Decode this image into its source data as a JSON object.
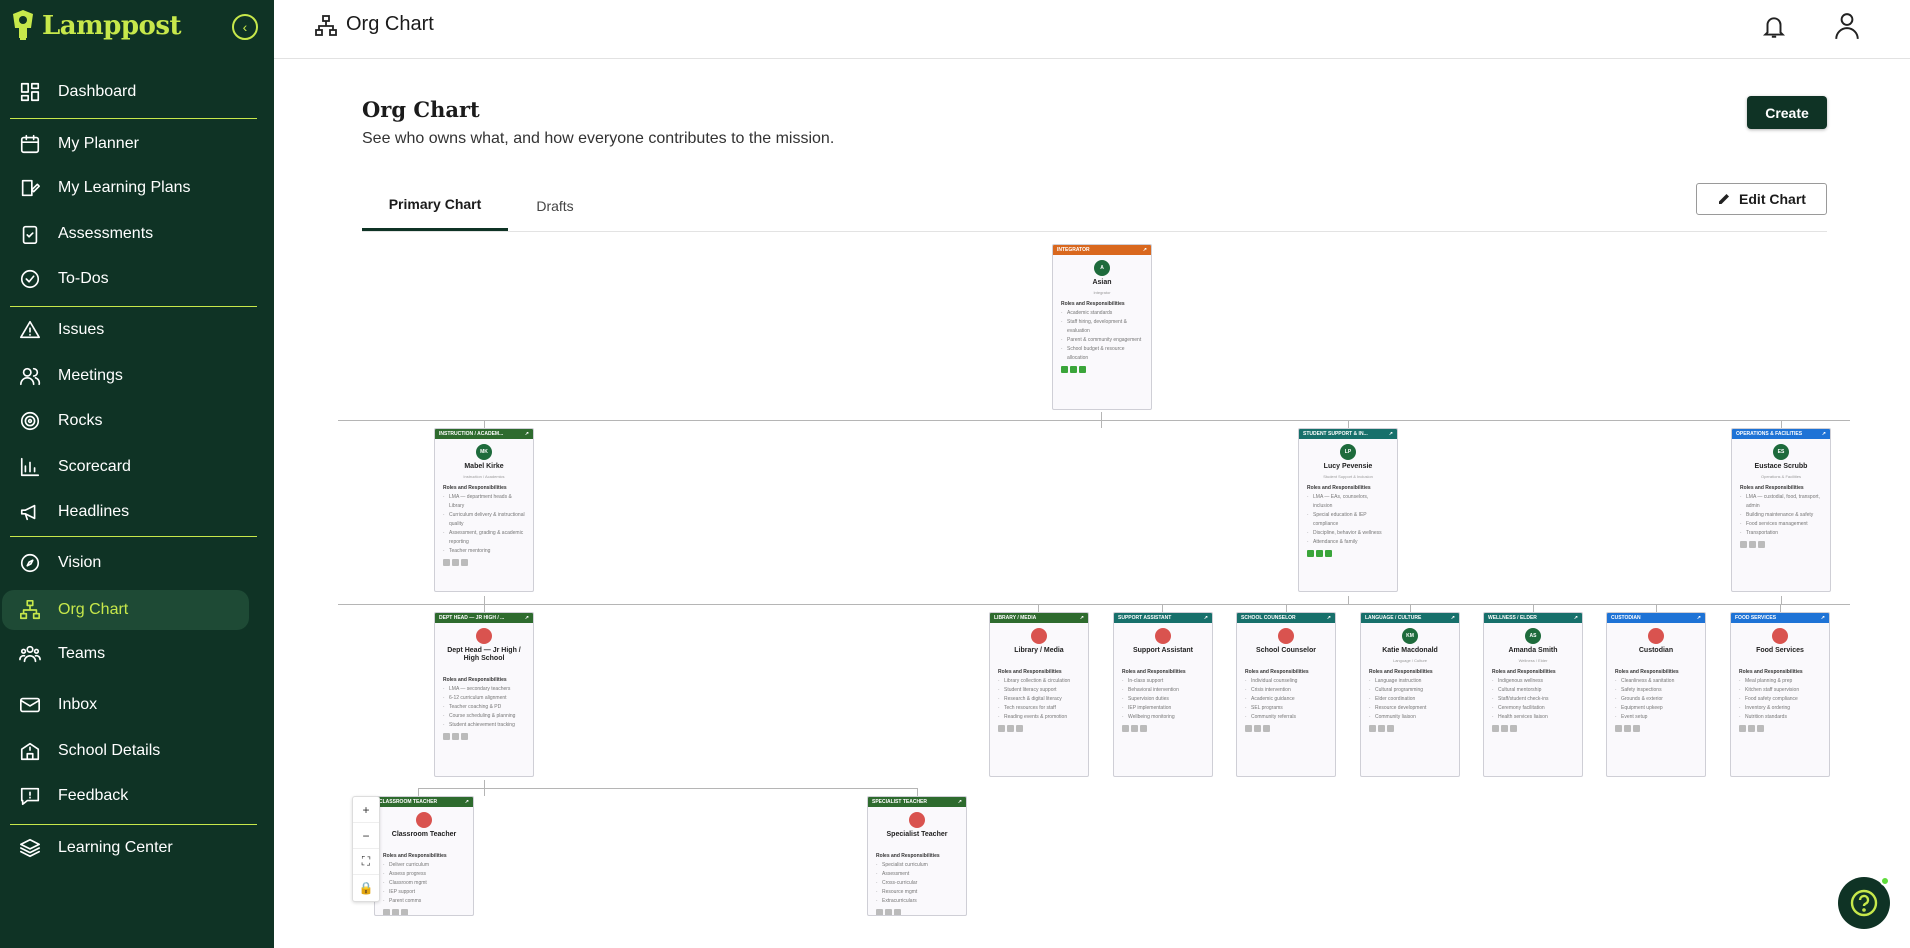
{
  "app": {
    "name": "Lamppost"
  },
  "colors": {
    "sidebar_bg": "#0f3325",
    "accent": "#c7e84b",
    "integrator": "#d9681e",
    "instruction": "#2e6b2e",
    "support": "#17706b",
    "operations": "#1e73d6"
  },
  "sidebar": {
    "items": [
      {
        "label": "Dashboard",
        "icon": "dashboard-icon"
      },
      {
        "label": "My Planner",
        "icon": "calendar-icon"
      },
      {
        "label": "My Learning Plans",
        "icon": "book-edit-icon"
      },
      {
        "label": "Assessments",
        "icon": "clipboard-check-icon"
      },
      {
        "label": "To-Dos",
        "icon": "check-circle-icon"
      },
      {
        "label": "Issues",
        "icon": "warning-icon"
      },
      {
        "label": "Meetings",
        "icon": "users-icon"
      },
      {
        "label": "Rocks",
        "icon": "target-icon"
      },
      {
        "label": "Scorecard",
        "icon": "bar-chart-icon"
      },
      {
        "label": "Headlines",
        "icon": "megaphone-icon"
      },
      {
        "label": "Vision",
        "icon": "compass-icon"
      },
      {
        "label": "Org Chart",
        "icon": "org-chart-icon",
        "active": true
      },
      {
        "label": "Teams",
        "icon": "team-icon"
      },
      {
        "label": "Inbox",
        "icon": "mail-icon"
      },
      {
        "label": "School Details",
        "icon": "school-icon"
      },
      {
        "label": "Feedback",
        "icon": "feedback-icon"
      },
      {
        "label": "Learning Center",
        "icon": "layers-icon"
      }
    ]
  },
  "header": {
    "title": "Org Chart"
  },
  "main": {
    "title": "Org Chart",
    "subtitle": "See who owns what, and how everyone contributes to the mission.",
    "create_label": "Create",
    "tabs": [
      "Primary Chart",
      "Drafts"
    ],
    "active_tab": "Primary Chart",
    "edit_label": "Edit Chart"
  },
  "org_chart": {
    "rr_label": "Roles and Responsibilities",
    "cards": [
      {
        "head": "INTEGRATOR",
        "color": "integrator",
        "initials": "A",
        "avatar": "#1e6b3c",
        "name": "Asian",
        "sub": "Integrator",
        "items": [
          "Academic standards",
          "Staff hiring, development & evaluation",
          "Parent & community engagement",
          "School budget & resource allocation"
        ],
        "tags": "green"
      },
      {
        "head": "INSTRUCTION / ACADEM...",
        "color": "instruction",
        "initials": "MK",
        "avatar": "#1e6b3c",
        "name": "Mabel Kirke",
        "sub": "Instruction / Academics",
        "items": [
          "LMA — department heads & Library",
          "Curriculum delivery & instructional quality",
          "Assessment, grading & academic reporting",
          "Teacher mentoring"
        ],
        "tags": "grey"
      },
      {
        "head": "STUDENT SUPPORT & IN...",
        "color": "support",
        "initials": "LP",
        "avatar": "#1e6b3c",
        "name": "Lucy Pevensie",
        "sub": "Student Support & Inclusion",
        "items": [
          "LMA — EAs, counselors, inclusion",
          "Special education & IEP compliance",
          "Discipline, behavior & wellness",
          "Attendance & family"
        ],
        "tags": "green"
      },
      {
        "head": "OPERATIONS & FACILITIES",
        "color": "operations",
        "initials": "ES",
        "avatar": "#1e6b3c",
        "name": "Eustace Scrubb",
        "sub": "Operations & Facilities",
        "items": [
          "LMA — custodial, food, transport, admin",
          "Building maintenance & safety",
          "Food services management",
          "Transportation"
        ],
        "tags": "grey"
      },
      {
        "head": "DEPT HEAD — JR HIGH / ...",
        "color": "instruction",
        "initials": "",
        "avatar": "#d9534f",
        "name": "Dept Head — Jr High / High School",
        "sub": "",
        "items": [
          "LMA — secondary teachers",
          "6-12 curriculum alignment",
          "Teacher coaching & PD",
          "Course scheduling & planning",
          "Student achievement tracking"
        ],
        "tags": "grey"
      },
      {
        "head": "LIBRARY / MEDIA",
        "color": "instruction",
        "initials": "",
        "avatar": "#d9534f",
        "name": "Library / Media",
        "sub": "",
        "items": [
          "Library collection & circulation",
          "Student literacy support",
          "Research & digital literacy",
          "Tech resources for staff",
          "Reading events & promotion"
        ],
        "tags": "grey"
      },
      {
        "head": "SUPPORT ASSISTANT",
        "color": "support",
        "initials": "",
        "avatar": "#d9534f",
        "name": "Support Assistant",
        "sub": "",
        "items": [
          "In-class support",
          "Behavioral intervention",
          "Supervision duties",
          "IEP implementation",
          "Wellbeing monitoring"
        ],
        "tags": "grey"
      },
      {
        "head": "SCHOOL COUNSELOR",
        "color": "support",
        "initials": "",
        "avatar": "#d9534f",
        "name": "School Counselor",
        "sub": "",
        "items": [
          "Individual counseling",
          "Crisis intervention",
          "Academic guidance",
          "SEL programs",
          "Community referrals"
        ],
        "tags": "grey"
      },
      {
        "head": "LANGUAGE / CULTURE",
        "color": "support",
        "initials": "KM",
        "avatar": "#1e6b3c",
        "name": "Katie Macdonald",
        "sub": "Language / Culture",
        "items": [
          "Language instruction",
          "Cultural programming",
          "Elder coordination",
          "Resource development",
          "Community liaison"
        ],
        "tags": "grey"
      },
      {
        "head": "WELLNESS / ELDER",
        "color": "support",
        "initials": "AS",
        "avatar": "#1e6b3c",
        "name": "Amanda Smith",
        "sub": "Wellness / Elder",
        "items": [
          "Indigenous wellness",
          "Cultural mentorship",
          "Staff/student check-ins",
          "Ceremony facilitation",
          "Health services liaison"
        ],
        "tags": "grey"
      },
      {
        "head": "CUSTODIAN",
        "color": "operations",
        "initials": "",
        "avatar": "#d9534f",
        "name": "Custodian",
        "sub": "",
        "items": [
          "Cleanliness & sanitation",
          "Safety inspections",
          "Grounds & exterior",
          "Equipment upkeep",
          "Event setup"
        ],
        "tags": "grey"
      },
      {
        "head": "FOOD SERVICES",
        "color": "operations",
        "initials": "",
        "avatar": "#d9534f",
        "name": "Food Services",
        "sub": "",
        "items": [
          "Meal planning & prep",
          "Kitchen staff supervision",
          "Food safety compliance",
          "Inventory & ordering",
          "Nutrition standards"
        ],
        "tags": "grey"
      },
      {
        "head": "CLASSROOM TEACHER",
        "color": "instruction",
        "initials": "",
        "avatar": "#d9534f",
        "name": "Classroom Teacher",
        "sub": "",
        "items": [
          "Deliver curriculum",
          "Assess progress",
          "Classroom mgmt",
          "IEP support",
          "Parent comms"
        ],
        "tags": "grey"
      },
      {
        "head": "SPECIALIST TEACHER",
        "color": "instruction",
        "initials": "",
        "avatar": "#d9534f",
        "name": "Specialist Teacher",
        "sub": "",
        "items": [
          "Specialist curriculum",
          "Assessment",
          "Cross-curricular",
          "Resource mgmt",
          "Extracurriculars"
        ],
        "tags": "grey"
      }
    ]
  },
  "zoom_controls": [
    "+",
    "−",
    "⛶",
    "🔒"
  ]
}
